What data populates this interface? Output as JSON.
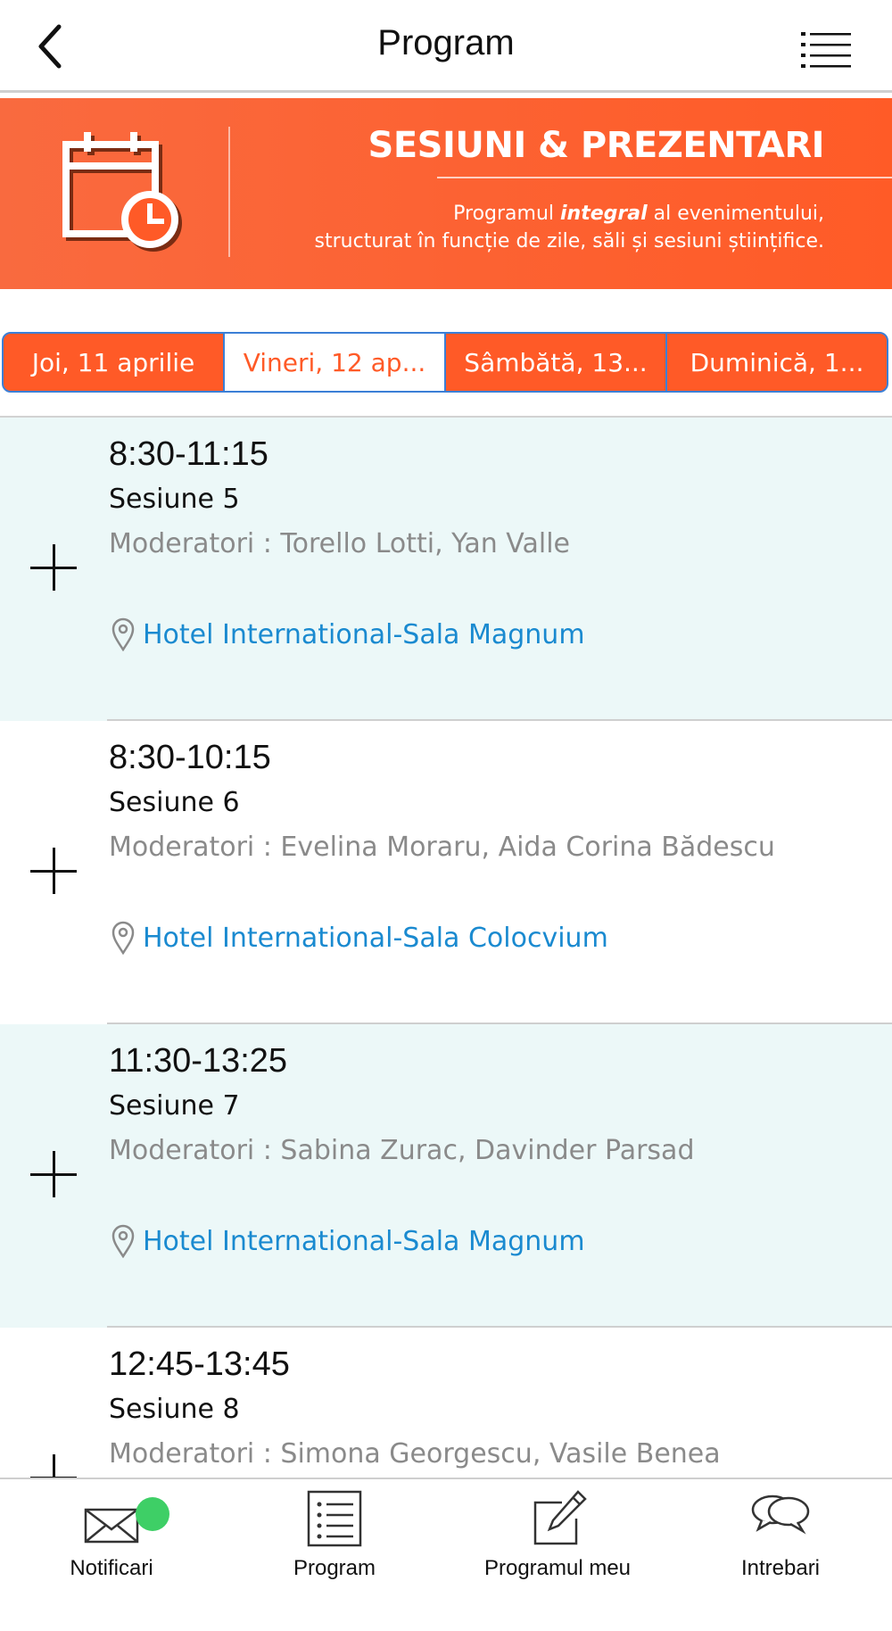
{
  "header": {
    "title": "Program",
    "back_icon": "chevron-left-icon",
    "menu_icon": "list-menu-icon"
  },
  "banner": {
    "heading": "SESIUNI & PREZENTARI",
    "line1_before": "Programul ",
    "line1_bold": "integral",
    "line1_after": " al evenimentului,",
    "line2": "structurat în funcție de zile, săli și sesiuni științifice.",
    "icon": "calendar-clock-icon",
    "color": "#ff5a27"
  },
  "tabs": [
    {
      "label": "Joi, 11 aprilie",
      "active": false
    },
    {
      "label": "Vineri, 12 ap...",
      "active": true
    },
    {
      "label": "Sâmbătă, 13...",
      "active": false
    },
    {
      "label": "Duminică, 1...",
      "active": false
    }
  ],
  "sessions": [
    {
      "time": "8:30-11:15",
      "name": "Sesiune 5",
      "moderators": "Moderatori : Torello Lotti, Yan Valle",
      "location": "Hotel International-Sala Magnum"
    },
    {
      "time": "8:30-10:15",
      "name": "Sesiune 6",
      "moderators": "Moderatori : Evelina Moraru, Aida Corina Bădescu",
      "location": "Hotel International-Sala Colocvium"
    },
    {
      "time": "11:30-13:25",
      "name": "Sesiune 7",
      "moderators": "Moderatori : Sabina Zurac, Davinder Parsad",
      "location": "Hotel International-Sala Magnum"
    },
    {
      "time": "12:45-13:45",
      "name": "Sesiune 8",
      "moderators": "Moderatori : Simona Georgescu, Vasile Benea",
      "location": ""
    }
  ],
  "bottom_nav": [
    {
      "label": "Notificari",
      "icon": "envelope-icon"
    },
    {
      "label": "Program",
      "icon": "list-icon"
    },
    {
      "label": "Programul meu",
      "icon": "edit-icon"
    },
    {
      "label": "Intrebari",
      "icon": "chat-bubbles-icon"
    }
  ],
  "colors": {
    "accent": "#ff5a27",
    "link": "#1a8ad0",
    "tint": "#ecf8f8",
    "badge": "#3ecf66"
  }
}
